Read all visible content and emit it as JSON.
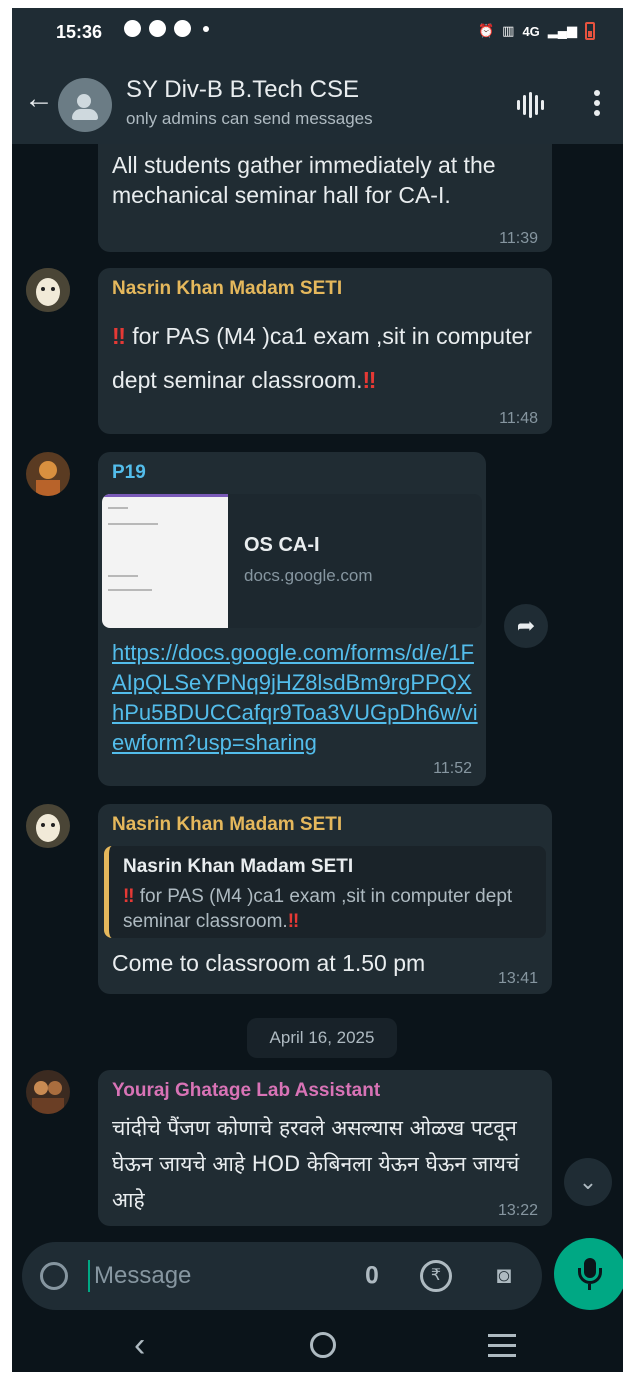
{
  "status_bar": {
    "time": "15:36",
    "network": "4G",
    "icons": [
      "chat-bubble-icon",
      "app-icon",
      "app-icon",
      "alarm-icon",
      "vibrate-icon",
      "volte-icon",
      "signal-icon",
      "battery-low-icon"
    ],
    "battery_color": "#e7533f"
  },
  "header": {
    "title": "SY Div-B B.Tech CSE",
    "subtitle": "only admins can send messages",
    "back_icon": "back-arrow-icon",
    "avatar_icon": "group-avatar-icon",
    "actions": [
      "voice-chat-icon",
      "more-options-icon"
    ]
  },
  "messages": [
    {
      "text": "All students gather immediately at the mechanical seminar hall for CA-I.",
      "time": "11:39"
    },
    {
      "sender": "Nasrin Khan Madam SETI",
      "sender_color": "#e5b85c",
      "text_pre": "‼",
      "text": " for PAS (M4 )ca1 exam ,sit in computer dept seminar classroom.",
      "text_post": "‼",
      "time": "11:48"
    },
    {
      "sender": "P19",
      "sender_color": "#53bdeb",
      "preview_title": "OS CA-I",
      "preview_domain": "docs.google.com",
      "link": "https://docs.google.com/forms/d/e/1FAIpQLSeYPNq9jHZ8lsdBm9rgPPQXhPu5BDUCCafqr9Toa3VUGpDh6w/viewform?usp=sharing",
      "time": "11:52"
    },
    {
      "sender": "Nasrin Khan Madam SETI",
      "sender_color": "#e5b85c",
      "quote_sender": "Nasrin Khan Madam SETI",
      "quote_pre": "‼",
      "quote_text": " for PAS (M4 )ca1 exam ,sit in computer dept seminar classroom.",
      "quote_post": "‼",
      "text": "Come to classroom at 1.50 pm",
      "time": "13:41"
    },
    {
      "sender": "Youraj Ghatage Lab Assistant",
      "sender_color": "#d873b6",
      "text": "चांदीचे पैंजण कोणाचे हरवले असल्यास ओळख पटवून घेऊन जायचे आहे HOD  केबिनला येऊन घेऊन जायचं आहे",
      "time": "13:22"
    }
  ],
  "date_separator": "April 16, 2025",
  "composer": {
    "placeholder": "Message",
    "icons": [
      "emoji-icon",
      "attach-icon",
      "payment-icon",
      "camera-icon",
      "mic-icon"
    ],
    "accent": "#00a884"
  },
  "nav_bar": {
    "icons": [
      "nav-back-icon",
      "nav-home-icon",
      "nav-recents-icon"
    ]
  }
}
